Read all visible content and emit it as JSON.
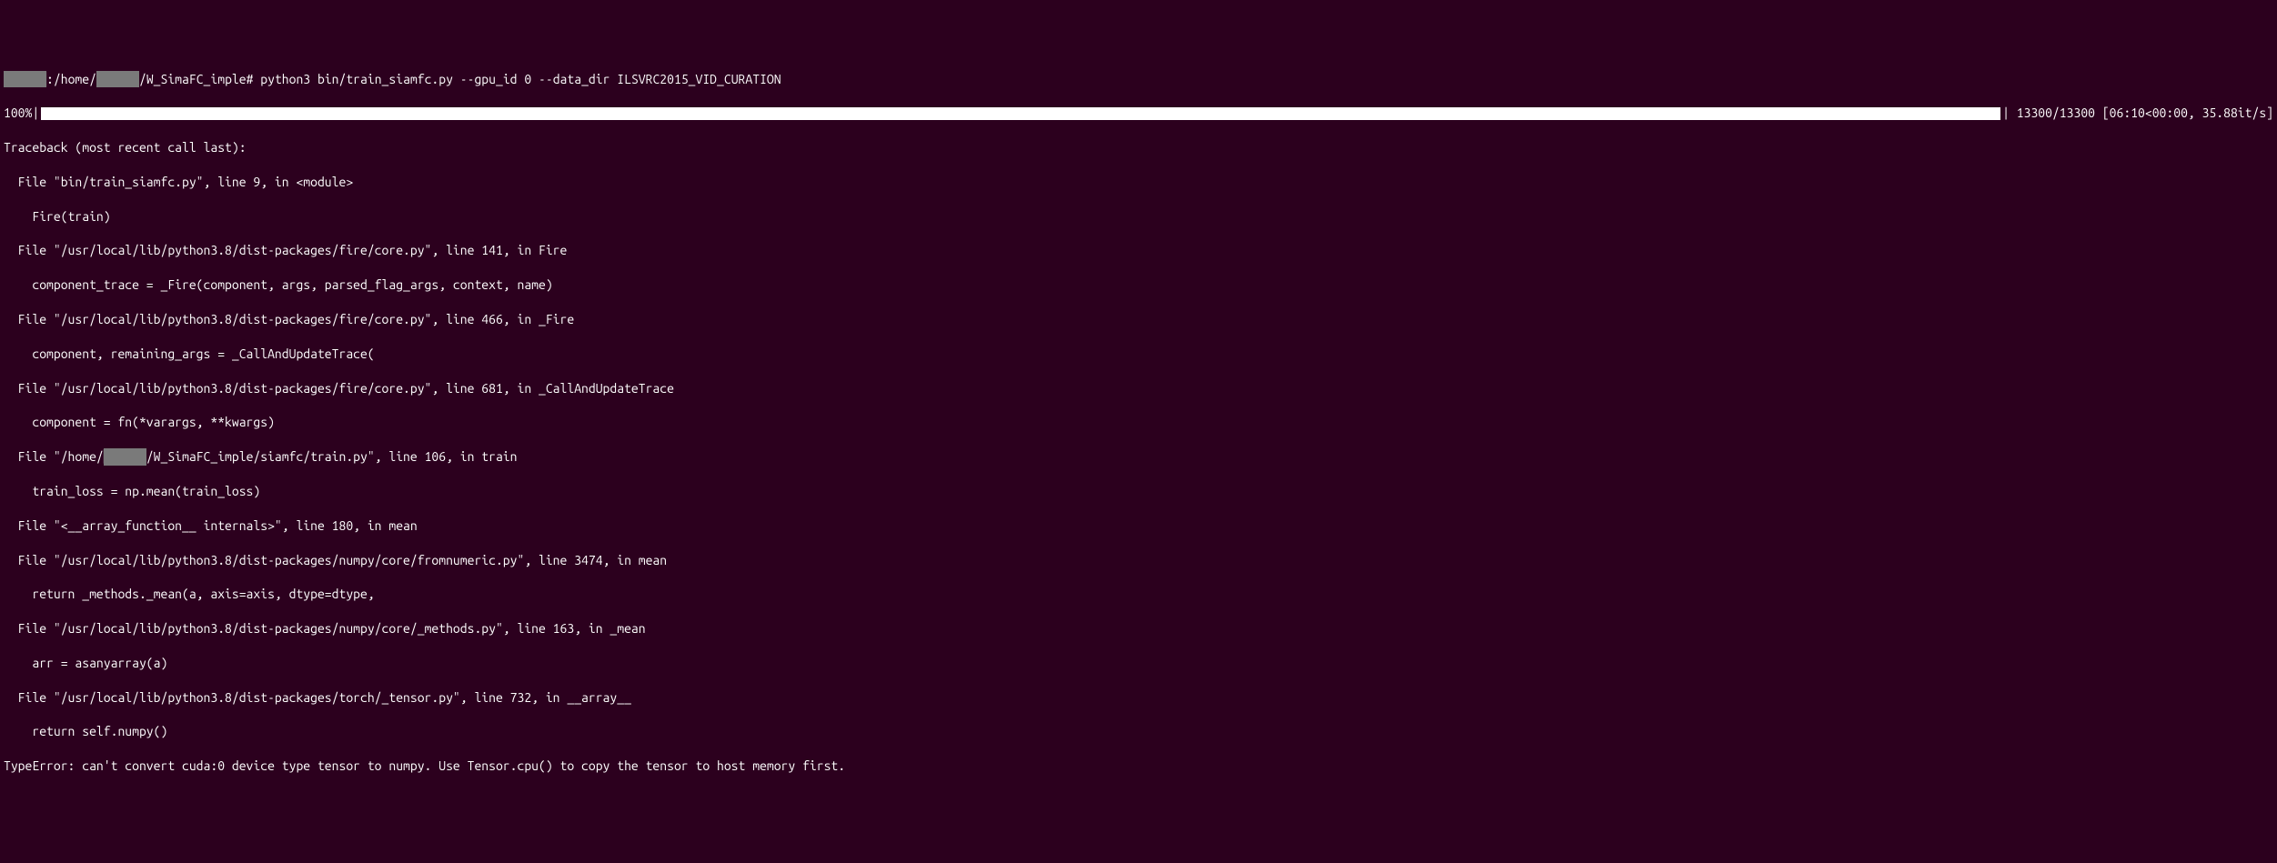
{
  "prompt": {
    "prefix_redacted": "██████",
    "path_part1": ":/home/",
    "user_redacted": "██████",
    "path_part2": "/W_SimaFC_imple# ",
    "command": "python3 bin/train_siamfc.py --gpu_id 0 --data_dir ILSVRC2015_VID_CURATION"
  },
  "progress": {
    "percent": "100%",
    "bar_char": "|",
    "stats": "| 13300/13300 [06:10<00:00, 35.88it/s]"
  },
  "traceback": {
    "header": "Traceback (most recent call last):",
    "frames": [
      {
        "file": "  File \"bin/train_siamfc.py\", line 9, in <module>",
        "code": "    Fire(train)"
      },
      {
        "file": "  File \"/usr/local/lib/python3.8/dist-packages/fire/core.py\", line 141, in Fire",
        "code": "    component_trace = _Fire(component, args, parsed_flag_args, context, name)"
      },
      {
        "file": "  File \"/usr/local/lib/python3.8/dist-packages/fire/core.py\", line 466, in _Fire",
        "code": "    component, remaining_args = _CallAndUpdateTrace("
      },
      {
        "file": "  File \"/usr/local/lib/python3.8/dist-packages/fire/core.py\", line 681, in _CallAndUpdateTrace",
        "code": "    component = fn(*varargs, **kwargs)"
      },
      {
        "file_part1": "  File \"/home/",
        "file_redacted": "██████",
        "file_part2": "/W_SimaFC_imple/siamfc/train.py\", line 106, in train",
        "code": "    train_loss = np.mean(train_loss)"
      },
      {
        "file": "  File \"<__array_function__ internals>\", line 180, in mean",
        "code": null
      },
      {
        "file": "  File \"/usr/local/lib/python3.8/dist-packages/numpy/core/fromnumeric.py\", line 3474, in mean",
        "code": "    return _methods._mean(a, axis=axis, dtype=dtype,"
      },
      {
        "file": "  File \"/usr/local/lib/python3.8/dist-packages/numpy/core/_methods.py\", line 163, in _mean",
        "code": "    arr = asanyarray(a)"
      },
      {
        "file": "  File \"/usr/local/lib/python3.8/dist-packages/torch/_tensor.py\", line 732, in __array__",
        "code": "    return self.numpy()"
      }
    ],
    "error": "TypeError: can't convert cuda:0 device type tensor to numpy. Use Tensor.cpu() to copy the tensor to host memory first."
  }
}
